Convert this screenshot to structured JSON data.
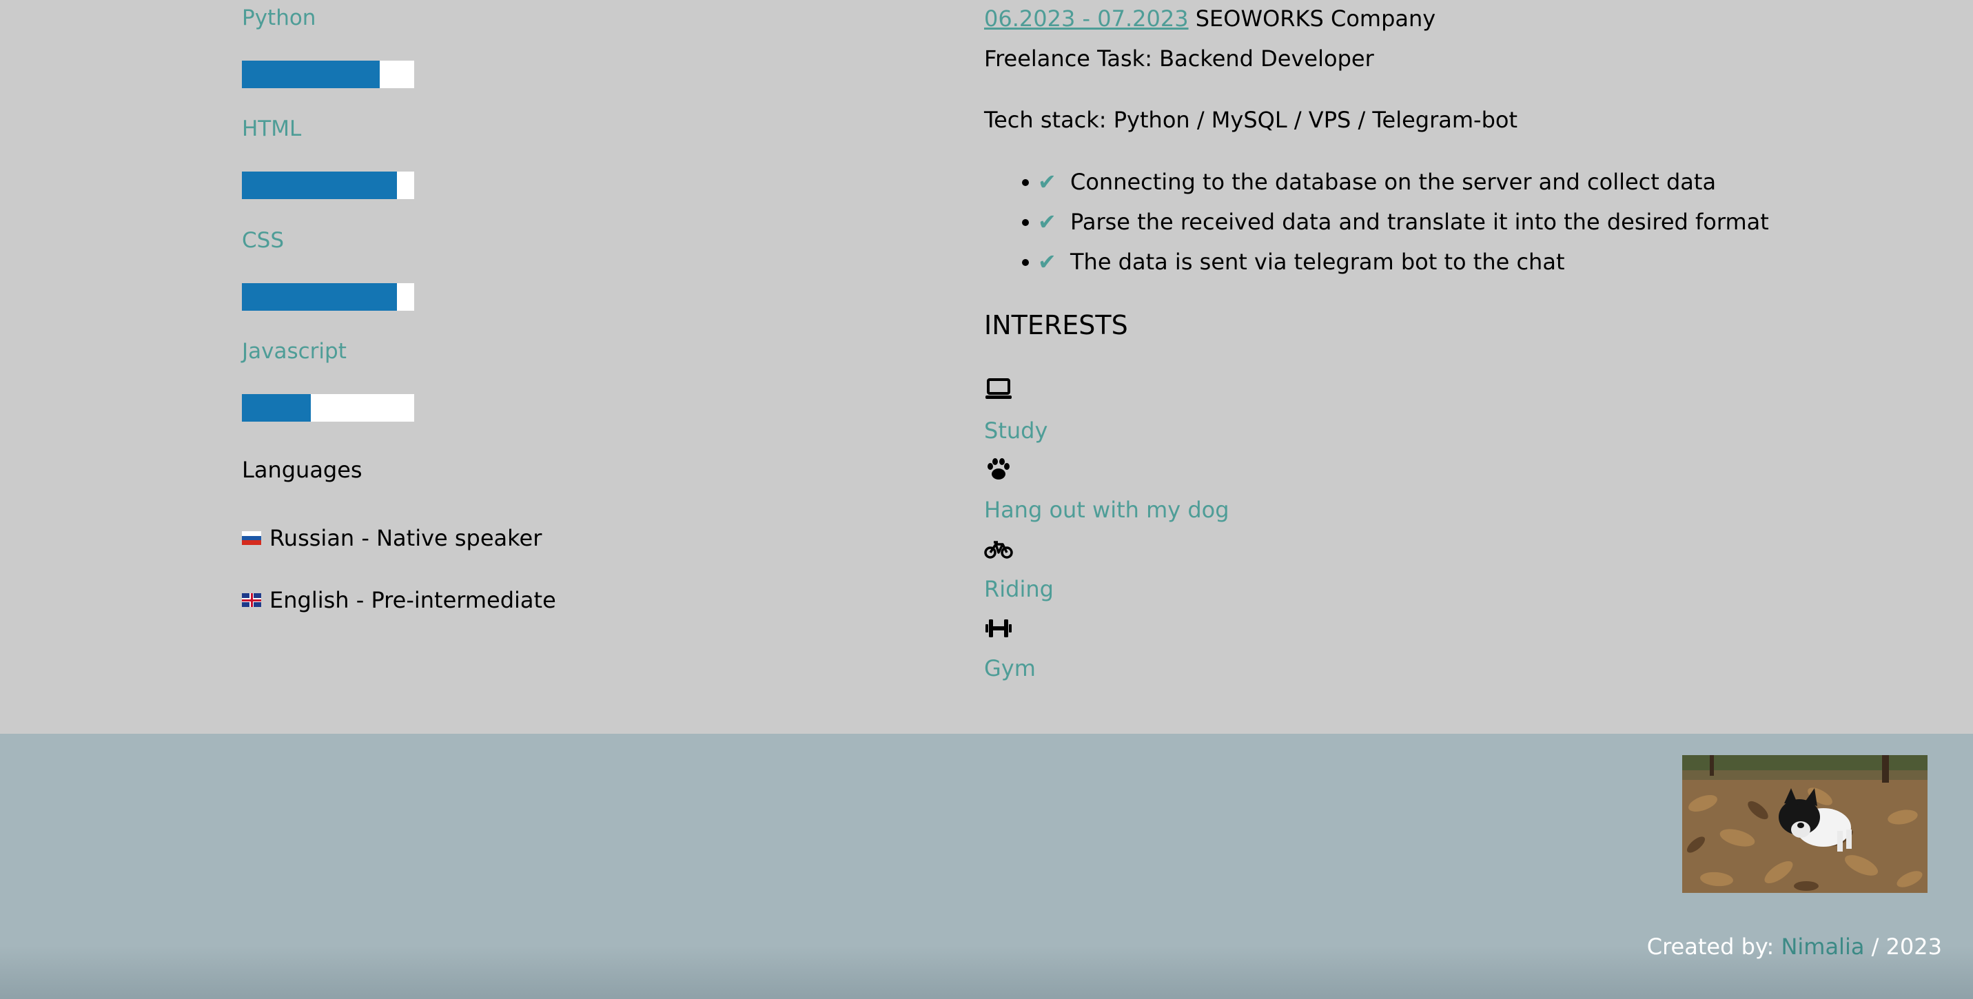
{
  "skills": {
    "items": [
      {
        "name": "Python",
        "level": 0.8
      },
      {
        "name": "HTML",
        "level": 0.9
      },
      {
        "name": "CSS",
        "level": 0.9
      },
      {
        "name": "Javascript",
        "level": 0.4
      }
    ]
  },
  "languages": {
    "title": "Languages",
    "items": [
      {
        "flag": "russia-flag",
        "text": "Russian - Native speaker"
      },
      {
        "flag": "uk-flag",
        "text": "English - Pre-intermediate"
      }
    ]
  },
  "experience": {
    "date": "06.2023 - 07.2023",
    "company": "SEOWORKS Company",
    "role": "Freelance Task: Backend Developer",
    "stack": "Tech stack: Python / MySQL / VPS / Telegram-bot",
    "check_glyph": "✔",
    "bullets": [
      "Connecting to the database on the server and collect data",
      "Parse the received data and translate it into the desired format",
      "The data is sent via telegram bot to the chat"
    ]
  },
  "interests": {
    "title": "INTERESTS",
    "items": [
      {
        "icon": "laptop-icon",
        "label": "Study"
      },
      {
        "icon": "paw-icon",
        "label": "Hang out with my dog"
      },
      {
        "icon": "bicycle-icon",
        "label": "Riding"
      },
      {
        "icon": "dumbbell-icon",
        "label": "Gym"
      }
    ]
  },
  "footer": {
    "prefix": "Created by:",
    "author": "Nimalia",
    "suffix": "/ 2023"
  },
  "colors": {
    "accent": "#4e9d97",
    "bar_fill": "#1475b3",
    "page_bg": "#cbcbcb",
    "footer_bg": "#a5b6bc"
  }
}
